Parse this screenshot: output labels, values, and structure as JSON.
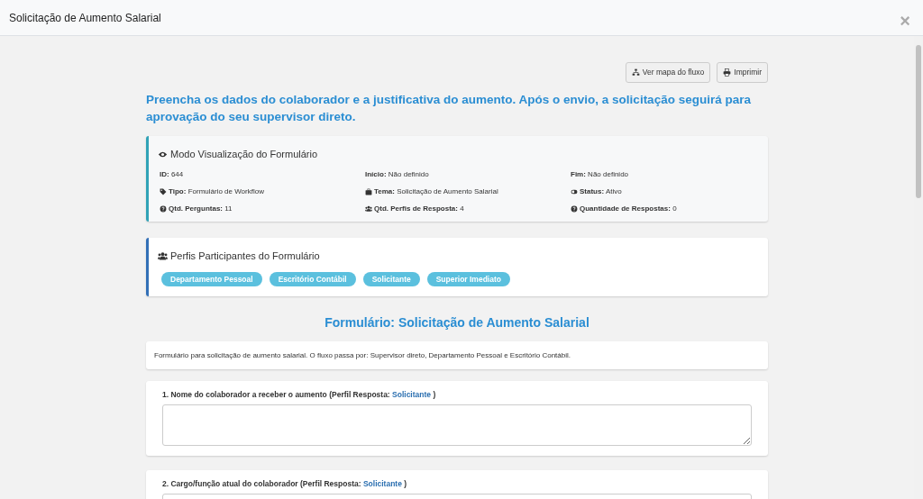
{
  "modal": {
    "title": "Solicitação de Aumento Salarial",
    "close": "×"
  },
  "toolbar": [
    {
      "kind": "flow",
      "label": "Ver mapa do fluxo"
    },
    {
      "kind": "print",
      "label": "Imprimir"
    }
  ],
  "intro": "Preencha os dados do colaborador e a justificativa do aumento. Após o envio, a solicitação seguirá para aprovação do seu supervisor direto.",
  "info_card": {
    "title": "Modo Visualização do Formulário",
    "items": [
      {
        "kind": "plain",
        "text": "**ID:** 644"
      },
      {
        "kind": "plain",
        "text": "**Início:** Não definido"
      },
      {
        "kind": "plain",
        "text": "**Fim:** Não definido"
      },
      {
        "kind": "tag",
        "text": "**Tipo:** Formulário de Workflow"
      },
      {
        "kind": "briefcase",
        "text": "**Tema:** Solicitação de Aumento Salarial"
      },
      {
        "kind": "toggle",
        "text": "**Status:** Ativo"
      },
      {
        "kind": "question",
        "text": "**Qtd. Perguntas:** 11"
      },
      {
        "kind": "users",
        "text": "**Qtd. Perfis de Resposta:** 4"
      },
      {
        "kind": "question",
        "text": "**Quantidade de Respostas:** 0"
      }
    ]
  },
  "profiles_card": {
    "title": "Perfis Participantes do Formulário",
    "profiles": [
      "Departamento Pessoal",
      "Escritório Contábil",
      "Solicitante",
      "Superior Imediato"
    ]
  },
  "form_title": "Formulário: Solicitação de Aumento Salarial",
  "description": "Formulário para solicitação de aumento salarial. O fluxo passa por: Supervisor direto, Departamento Pessoal e Escritório Contábil.",
  "questions": [
    {
      "label": "1. Nome do colaborador a receber o aumento (Perfil Resposta: ",
      "profile": "Solicitante",
      "suffix": " )"
    },
    {
      "label": "2. Cargo/função atual do colaborador (Perfil Resposta: ",
      "profile": "Solicitante",
      "suffix": " )"
    }
  ]
}
